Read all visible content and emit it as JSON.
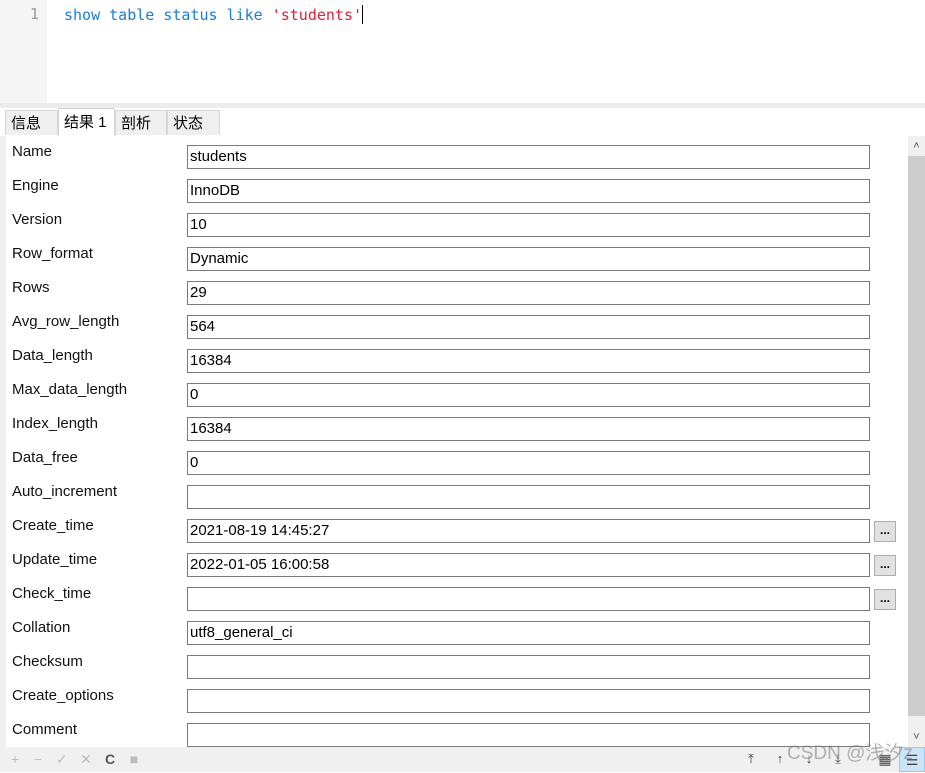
{
  "editor": {
    "line_number": "1",
    "code_keywords": "show table status like ",
    "code_string": "'students'"
  },
  "tabs": [
    {
      "label": "信息",
      "active": false
    },
    {
      "label": "结果 1",
      "active": true
    },
    {
      "label": "剖析",
      "active": false
    },
    {
      "label": "状态",
      "active": false
    }
  ],
  "fields": [
    {
      "label": "Name",
      "value": "students"
    },
    {
      "label": "Engine",
      "value": "InnoDB"
    },
    {
      "label": "Version",
      "value": "10"
    },
    {
      "label": "Row_format",
      "value": "Dynamic"
    },
    {
      "label": "Rows",
      "value": "29"
    },
    {
      "label": "Avg_row_length",
      "value": "564"
    },
    {
      "label": "Data_length",
      "value": "16384"
    },
    {
      "label": "Max_data_length",
      "value": "0"
    },
    {
      "label": "Index_length",
      "value": "16384"
    },
    {
      "label": "Data_free",
      "value": "0"
    },
    {
      "label": "Auto_increment",
      "value": ""
    },
    {
      "label": "Create_time",
      "value": "2021-08-19 14:45:27",
      "ellipsis": "..."
    },
    {
      "label": "Update_time",
      "value": "2022-01-05 16:00:58",
      "ellipsis": "..."
    },
    {
      "label": "Check_time",
      "value": "",
      "ellipsis": "..."
    },
    {
      "label": "Collation",
      "value": "utf8_general_ci"
    },
    {
      "label": "Checksum",
      "value": ""
    },
    {
      "label": "Create_options",
      "value": ""
    },
    {
      "label": "Comment",
      "value": ""
    }
  ],
  "scrollbar": {
    "up_icon": "˄",
    "down_icon": "˅"
  },
  "statusbar": {
    "add_icon": "+",
    "remove_icon": "−",
    "apply_icon": "✓",
    "discard_icon": "✕",
    "refresh_icon": "C",
    "stop_icon": "■",
    "first_icon": "⤒",
    "prev_icon": "↑",
    "next_icon": "↓",
    "last_icon": "⤓",
    "grid_view_icon": "▦",
    "form_view_icon": "☰"
  },
  "watermark": "CSDN @浅汐z"
}
